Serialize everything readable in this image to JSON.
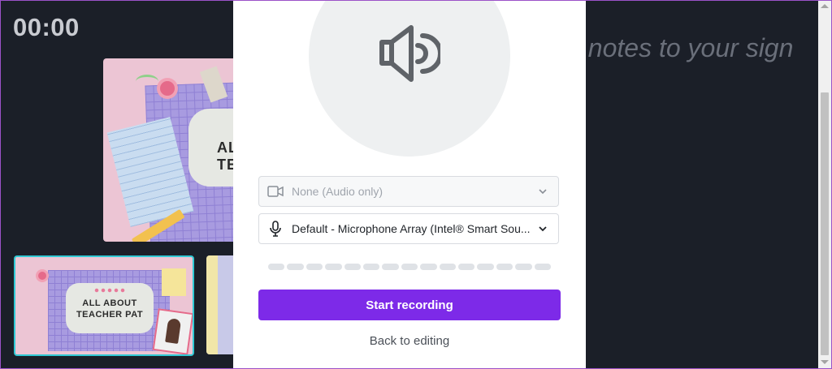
{
  "background": {
    "timer": "00:00",
    "notes_hint": "ld notes to your sign"
  },
  "slides": {
    "main_title": "AL TE",
    "thumb1_title": "ALL ABOUT TEACHER PAT"
  },
  "modal": {
    "camera_select": {
      "value": "None (Audio only)",
      "icon": "camera-icon"
    },
    "mic_select": {
      "value": "Default - Microphone Array (Intel® Smart Sou...",
      "icon": "microphone-icon"
    },
    "level_segments": 15,
    "start_button": "Start recording",
    "back_link": "Back to editing"
  },
  "colors": {
    "accent": "#7d2ae8",
    "page_bg": "#1b1f28",
    "thumb_selected": "#30c9d4"
  }
}
